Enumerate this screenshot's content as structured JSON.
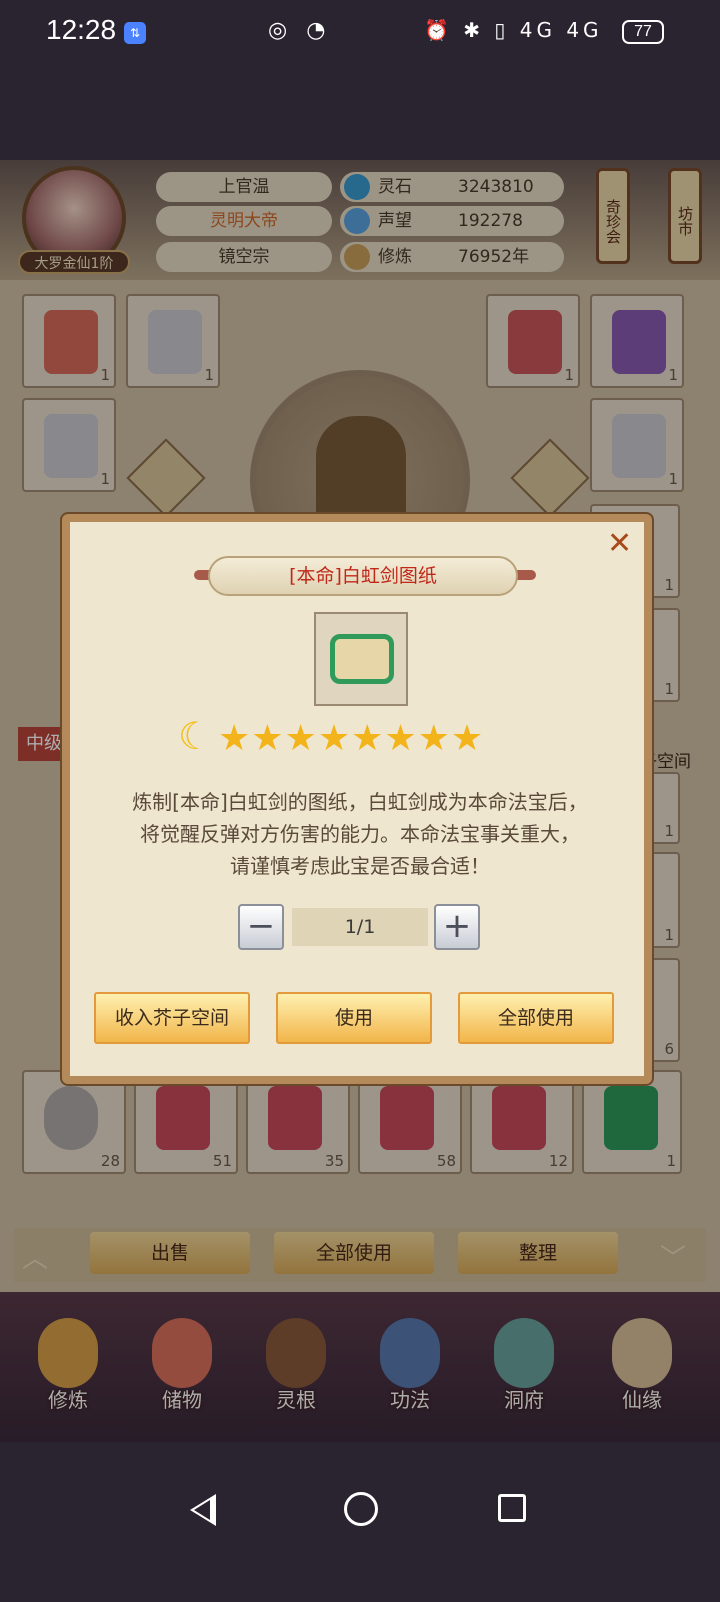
{
  "status_bar": {
    "time": "12:28",
    "badge": "⇅",
    "mid_icons": "◎ ◔",
    "right_icons": "⏰ ✱ ▯ 4G 4G",
    "battery": "77"
  },
  "player": {
    "name": "上官温",
    "title": "灵明大帝",
    "sect": "镜空宗",
    "rank": "大罗金仙1阶"
  },
  "stats": [
    {
      "label": "灵石",
      "value": "3243810",
      "icon": "spirit-stone-icon"
    },
    {
      "label": "声望",
      "value": "192278",
      "icon": "reputation-icon"
    },
    {
      "label": "修炼",
      "value": "76952年",
      "icon": "cultivation-icon"
    }
  ],
  "lanterns": [
    "奇珍会",
    "坊市"
  ],
  "equipment_slots": [
    {
      "count": "1"
    },
    {
      "count": "1"
    },
    {
      "count": "1"
    },
    {
      "count": "1"
    },
    {
      "count": "1"
    },
    {
      "count": "1"
    }
  ],
  "side_labels": {
    "left": "中级",
    "right": "子空间"
  },
  "inventory_row": [
    {
      "count": "28"
    },
    {
      "count": "51"
    },
    {
      "count": "35"
    },
    {
      "count": "58"
    },
    {
      "count": "12"
    },
    {
      "count": "1"
    }
  ],
  "partial_counts": [
    "1",
    "1",
    "6",
    "1",
    "1"
  ],
  "bottom_buttons": [
    "出售",
    "全部使用",
    "整理"
  ],
  "nav": [
    {
      "label": "修炼"
    },
    {
      "label": "储物"
    },
    {
      "label": "灵根"
    },
    {
      "label": "功法"
    },
    {
      "label": "洞府"
    },
    {
      "label": "仙缘"
    }
  ],
  "dialog": {
    "title": "[本命]白虹剑图纸",
    "close": "✕",
    "moon": "☾",
    "stars": "★★★★★★★★",
    "star_count": 8,
    "description_lines": [
      "炼制[本命]白虹剑的图纸，白虹剑成为本命法宝后，",
      "将觉醒反弹对方伤害的能力。本命法宝事关重大，",
      "请谨慎考虑此宝是否最合适！"
    ],
    "minus": "−",
    "plus": "+",
    "quantity": "1/1",
    "buttons": [
      "收入芥子空间",
      "使用",
      "全部使用"
    ]
  },
  "colors": {
    "title_red": "#c0281a",
    "star_gold": "#f2b41a",
    "button_orange": "#f1b54a"
  }
}
